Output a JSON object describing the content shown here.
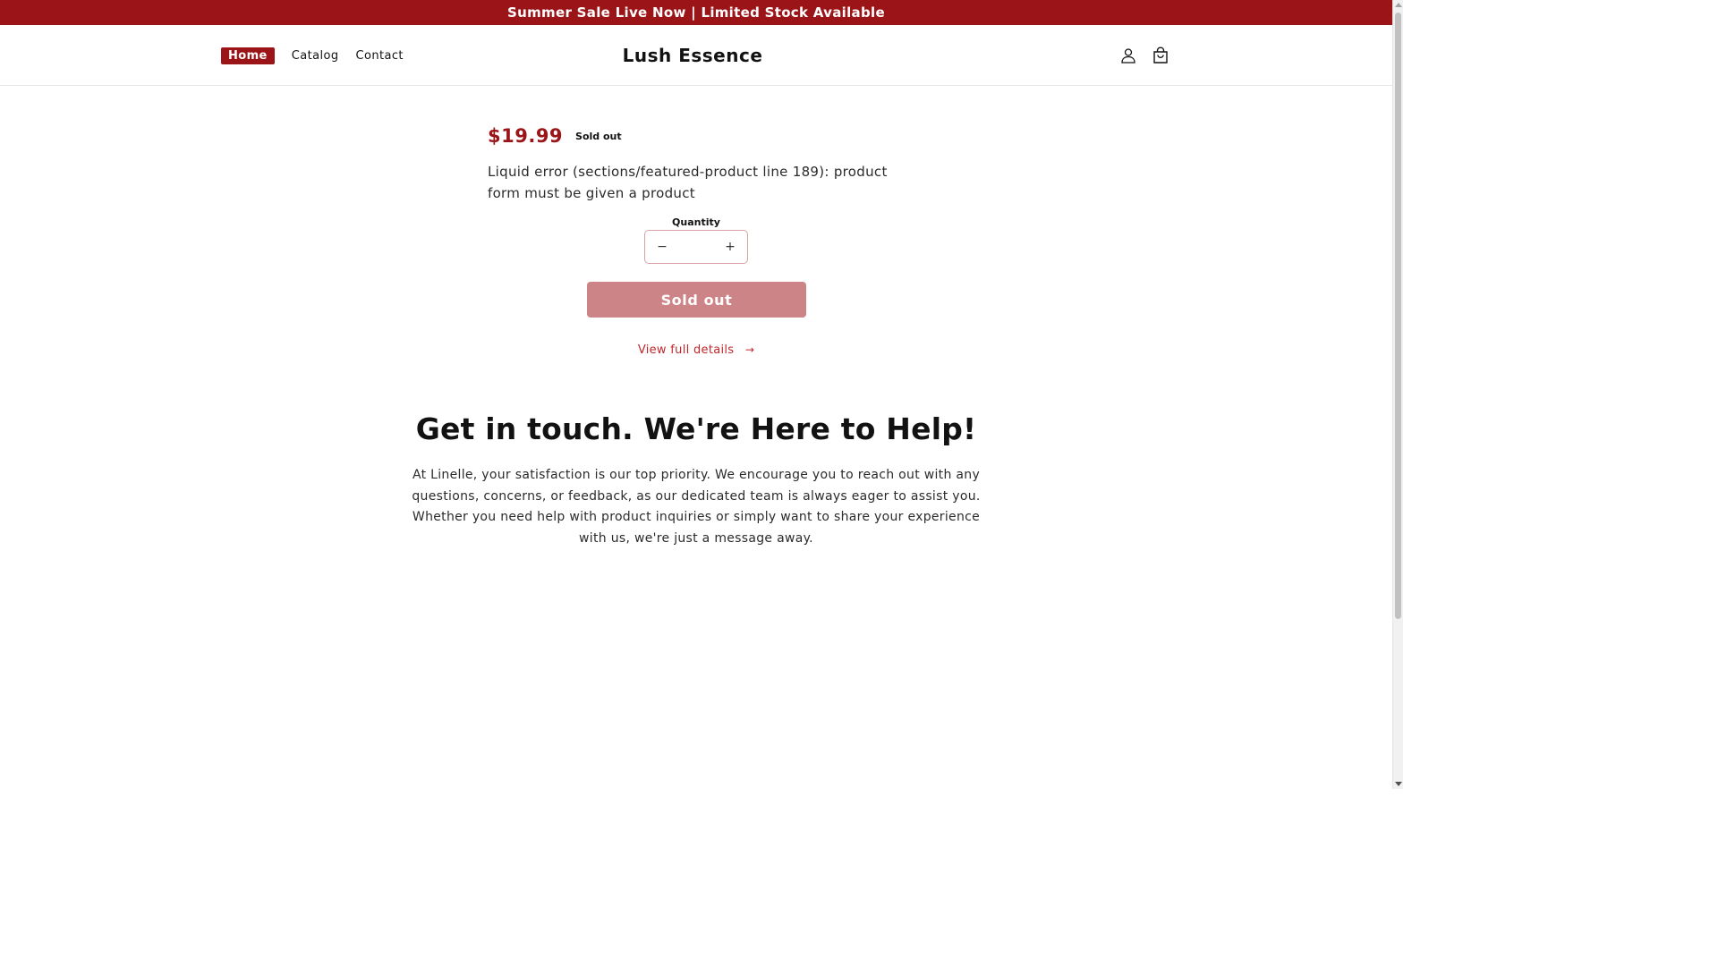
{
  "announcement": {
    "text": "Summer Sale Live Now | Limited Stock Available"
  },
  "header": {
    "nav": [
      {
        "label": "Home",
        "active": true
      },
      {
        "label": "Catalog",
        "active": false
      },
      {
        "label": "Contact",
        "active": false
      }
    ],
    "logo": "Lush Essence",
    "icons": [
      "account-icon",
      "cart-icon"
    ]
  },
  "product": {
    "price": "$19.99",
    "badge": "Sold out",
    "error": "Liquid error (sections/featured-product line 189): product form must be given a product",
    "quantity_label": "Quantity",
    "quantity_value": "",
    "decrease_symbol": "−",
    "increase_symbol": "+",
    "button_label": "Sold out",
    "details_link": "View full details",
    "details_arrow": "→"
  },
  "contact": {
    "title": "Get in touch. We're Here to Help!",
    "text": "At Linelle, your satisfaction is our top priority. We encourage you to reach out with any questions, concerns, or feedback, as our dedicated team is always eager to assist you. Whether you need help with product inquiries or simply want to share your experience with us, we're just a message away."
  },
  "colors": {
    "brand": "#9b1518",
    "button_disabled": "#cd8486",
    "link": "#c0272b"
  }
}
